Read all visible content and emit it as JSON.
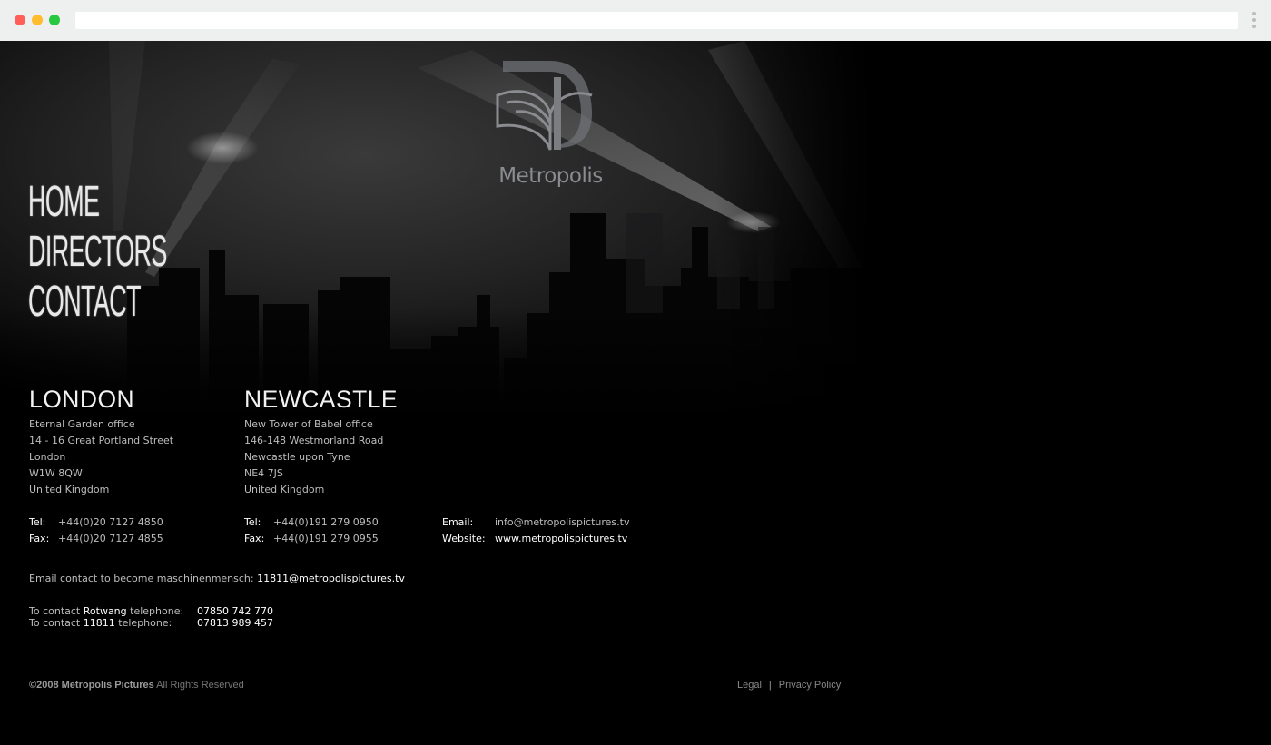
{
  "nav": {
    "items": [
      "HOME",
      "DIRECTORS",
      "CONTACT"
    ]
  },
  "logo": {
    "text": "Metropolis"
  },
  "london": {
    "title": "LONDON",
    "address": [
      "Eternal Garden office",
      "14 - 16 Great Portland Street",
      "London",
      "W1W 8QW",
      "United Kingdom"
    ],
    "tel_label": "Tel:",
    "tel": "+44(0)20 7127 4850",
    "fax_label": "Fax:",
    "fax": "+44(0)20 7127 4855"
  },
  "newcastle": {
    "title": "NEWCASTLE",
    "address": [
      "New Tower of Babel office",
      "146-148 Westmorland Road",
      "Newcastle upon Tyne",
      "NE4 7JS",
      "United Kingdom"
    ],
    "tel_label": "Tel:",
    "tel": "+44(0)191 279 0950",
    "fax_label": "Fax:",
    "fax": "+44(0)191 279 0955"
  },
  "general": {
    "email_label": "Email:",
    "email": "info@metropolispictures.tv",
    "website_label": "Website:",
    "website": "www.metropolispictures.tv"
  },
  "machine": {
    "text": "Email contact to become maschinenmensch:",
    "email": "11811@metropolispictures.tv"
  },
  "phones": [
    {
      "prefix": "To contact",
      "name": "Rotwang",
      "suffix": "telephone:",
      "number": "07850 742 770"
    },
    {
      "prefix": "To contact",
      "name": "11811",
      "suffix": "telephone:",
      "number": "07813 989 457"
    }
  ],
  "footer": {
    "copyright": "©2008 Metropolis Pictures",
    "rights": "All Rights Reserved",
    "legal": "Legal",
    "separator": "|",
    "privacy": "Privacy Policy"
  },
  "colors": {
    "background": "#000000",
    "text": "#bdbdbd",
    "highlight": "#ffffff"
  }
}
